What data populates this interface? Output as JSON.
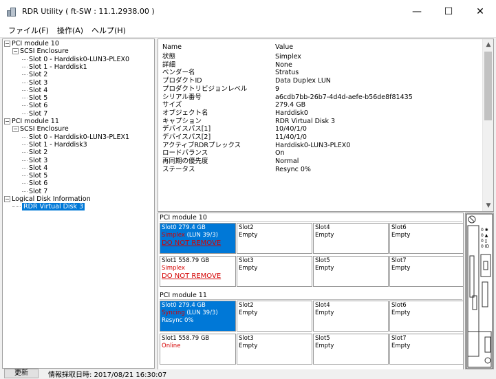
{
  "window": {
    "title": "RDR Utility ( ft-SW : 11.1.2938.00 )",
    "minimize": "—",
    "maximize": "☐",
    "close": "✕"
  },
  "menu": [
    "ファイル(F)",
    "操作(A)",
    "ヘルプ(H)"
  ],
  "tree": {
    "pci10": "PCI module 10",
    "enc10": "SCSI Enclosure",
    "slots10": [
      "Slot 0 - Harddisk0-LUN3-PLEX0",
      "Slot 1 - Harddisk1",
      "Slot 2",
      "Slot 3",
      "Slot 4",
      "Slot 5",
      "Slot 6",
      "Slot 7"
    ],
    "pci11": "PCI module 11",
    "enc11": "SCSI Enclosure",
    "slots11": [
      "Slot 0 - Harddisk0-LUN3-PLEX1",
      "Slot 1 - Harddisk3",
      "Slot 2",
      "Slot 3",
      "Slot 4",
      "Slot 5",
      "Slot 6",
      "Slot 7"
    ],
    "ldi": "Logical Disk Information",
    "vd": "RDR Virtual Disk 3",
    "expanded_sign": "−"
  },
  "properties": {
    "header": {
      "name": "Name",
      "value": "Value"
    },
    "rows": [
      {
        "name": "状態",
        "value": "Simplex"
      },
      {
        "name": "詳細",
        "value": "None"
      },
      {
        "name": "ベンダー名",
        "value": "Stratus"
      },
      {
        "name": "プロダクトID",
        "value": "Data Duplex LUN"
      },
      {
        "name": "プロダクトリビジョンレベル",
        "value": "9"
      },
      {
        "name": "シリアル番号",
        "value": "a6cdb7bb-26b7-4d4d-aefe-b56de8f81435"
      },
      {
        "name": "サイズ",
        "value": "279.4 GB"
      },
      {
        "name": "オブジェクト名",
        "value": "Harddisk0"
      },
      {
        "name": "キャプション",
        "value": "RDR Virtual Disk 3"
      },
      {
        "name": "デバイスパス[1]",
        "value": "10/40/1/0"
      },
      {
        "name": "デバイスパス[2]",
        "value": "11/40/1/0"
      },
      {
        "name": "アクティブRDRプレックス",
        "value": "Harddisk0-LUN3-PLEX0"
      },
      {
        "name": "ロードバランス",
        "value": "On"
      },
      {
        "name": "再同期の優先度",
        "value": "Normal"
      },
      {
        "name": "ステータス",
        "value": "Resync 0%"
      }
    ]
  },
  "modules": [
    {
      "label": "PCI module 10",
      "slots": [
        {
          "title": "Slot0  279.4 GB",
          "line2": "Simplex",
          "line2b": " (LUN 39/3)",
          "line3": "DO NOT REMOVE",
          "sel": true
        },
        {
          "title": "Slot2",
          "line2": "Empty"
        },
        {
          "title": "Slot4",
          "line2": "Empty"
        },
        {
          "title": "Slot6",
          "line2": "Empty"
        },
        {
          "title": "Slot1  558.79 GB",
          "line2": "Simplex",
          "line3": "DO NOT REMOVE"
        },
        {
          "title": "Slot3",
          "line2": "Empty"
        },
        {
          "title": "Slot5",
          "line2": "Empty"
        },
        {
          "title": "Slot7",
          "line2": "Empty"
        }
      ]
    },
    {
      "label": "PCI module 11",
      "slots": [
        {
          "title": "Slot0  279.4 GB",
          "line2": "Syncing",
          "line2b": " (LUN 39/3)",
          "line3": "Resync 0%",
          "sel": true
        },
        {
          "title": "Slot2",
          "line2": "Empty"
        },
        {
          "title": "Slot4",
          "line2": "Empty"
        },
        {
          "title": "Slot6",
          "line2": "Empty"
        },
        {
          "title": "Slot1  558.79 GB",
          "line2": "Online"
        },
        {
          "title": "Slot3",
          "line2": "Empty"
        },
        {
          "title": "Slot5",
          "line2": "Empty"
        },
        {
          "title": "Slot7",
          "line2": "Empty"
        }
      ]
    }
  ],
  "statusbar": {
    "refresh": "更新",
    "info": "情報採取日時: 2017/08/21 16:30:07"
  }
}
